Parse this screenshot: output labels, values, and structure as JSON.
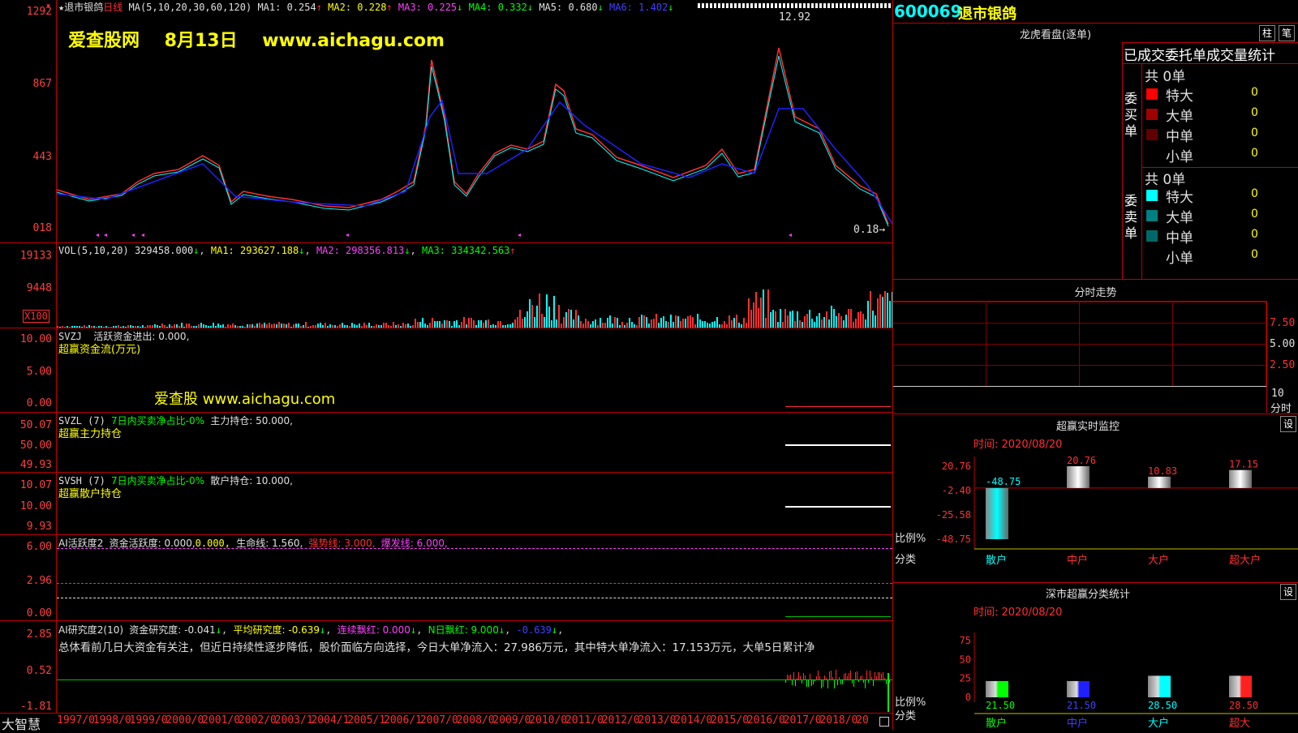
{
  "stock": {
    "code": "600069",
    "name": "退市银鸽"
  },
  "main_header": {
    "star": "★",
    "name": "退市银鸽",
    "period": "日线",
    "ma_def": "MA(5,10,20,30,60,120)",
    "ma1": "MA1: 0.254",
    "ma2": "MA2: 0.228",
    "ma3": "MA3: 0.225",
    "ma4": "MA4: 0.332",
    "ma5": "MA5: 0.680",
    "ma6": "MA6: 1.402"
  },
  "watermark": {
    "site": "爱查股网",
    "date": "8月13日",
    "url": "www.aichagu.com",
    "url2": "爱查股 www.aichagu.com"
  },
  "price_axis": [
    "1292",
    "867",
    "443",
    "018"
  ],
  "price_marks": {
    "high": "12.92",
    "low": "0.18"
  },
  "vol": {
    "def": "VOL(5,10,20)",
    "value": "329458.000",
    "ma1": "MA1: 293627.188",
    "ma2": "MA2: 298356.813",
    "ma3": "MA3: 334342.563",
    "axis": [
      "19133",
      "9448"
    ],
    "unit": "X100"
  },
  "svzj": {
    "name": "SVZJ",
    "label": "活跃资金进出: 0.000,",
    "title": "超赢资金流(万元)",
    "axis": [
      "10.00",
      "5.00",
      "0.00"
    ]
  },
  "svzl": {
    "name": "SVZL (7)",
    "green": "7日内买卖净占比-0%",
    "label": "主力持仓: 50.000,",
    "title": "超赢主力持仓",
    "axis": [
      "50.07",
      "50.00",
      "49.93"
    ]
  },
  "svsh": {
    "name": "SVSH (7)",
    "green": "7日内买卖净占比-0%",
    "label": "散户持仓: 10.000,",
    "title": "超赢散户持仓",
    "axis": [
      "10.07",
      "10.00",
      "9.93"
    ]
  },
  "ai1": {
    "name": "AI活跃度2",
    "l1": "资金活跃度: 0.000,",
    "l2": "0.000,",
    "l3": "生命线: 1.560,",
    "l4": "强势线: 3.000,",
    "l5": "爆发线: 6.000,",
    "axis": [
      "6.00",
      "2.96",
      "0.00"
    ]
  },
  "ai2": {
    "name": "AI研究度2(10)",
    "l1": "资金研究度: -0.041",
    "l2": "平均研究度: -0.639",
    "l3": "连续飘红: 0.000",
    "l4": "N日飘红: 9.000",
    "l5": "-0.639",
    "text": "总体看前几日大资金有关注，但近日持续性逐步降低，股价面临方向选择，今日大单净流入：27.986万元，其中特大单净流入：17.153万元，大单5日累计净",
    "axis": [
      "2.85",
      "0.52",
      "-1.81"
    ]
  },
  "brand": "大智慧",
  "years": [
    "1997/0",
    "1998/0",
    "1999/0",
    "2000/0",
    "2001/0",
    "2002/0",
    "2003/1",
    "2004/1",
    "2005/1",
    "2006/1",
    "2007/0",
    "2008/0",
    "2009/0",
    "2010/0",
    "2011/0",
    "2012/0",
    "2013/0",
    "2014/0",
    "2015/0",
    "2016/0",
    "2017/0",
    "2018/0",
    "20"
  ],
  "lhb": {
    "title": "龙虎看盘(逐单)",
    "btn1": "柱",
    "btn2": "笔",
    "subtitle": "已成交委托单成交量统计",
    "buy_label": "委买单",
    "sell_label": "委卖单",
    "buy": {
      "total": "共 0单",
      "rows": [
        {
          "name": "特大",
          "val": "0",
          "color": "#ff0000"
        },
        {
          "name": "大单",
          "val": "0",
          "color": "#a00000"
        },
        {
          "name": "中单",
          "val": "0",
          "color": "#600000"
        },
        {
          "name": "小单",
          "val": "0",
          "color": "#000000"
        }
      ]
    },
    "sell": {
      "total": "共 0单",
      "rows": [
        {
          "name": "特大",
          "val": "0",
          "color": "#00ffff"
        },
        {
          "name": "大单",
          "val": "0",
          "color": "#008080"
        },
        {
          "name": "中单",
          "val": "0",
          "color": "#006868"
        },
        {
          "name": "小单",
          "val": "0",
          "color": "#000000"
        }
      ]
    }
  },
  "fenshi": {
    "title": "分时走势",
    "axis": [
      "7.50",
      "5.00",
      "2.50"
    ],
    "xlabel_top": "10",
    "xlabel_bottom": "分时"
  },
  "monitor": {
    "title": "超赢实时监控",
    "btn": "设",
    "time": "时间: 2020/08/20",
    "axis": [
      "20.76",
      "-2.40",
      "-25.58",
      "-48.75"
    ],
    "ylabel": "比例%",
    "xlabel": "分类",
    "bars": [
      {
        "name": "散户",
        "value": -48.75,
        "label": "-48.75",
        "color": "#00ffff",
        "lcolor": "#00ffff"
      },
      {
        "name": "中户",
        "value": 20.76,
        "label": "20.76",
        "color": "#ffffff",
        "lcolor": "#ff3030"
      },
      {
        "name": "大户",
        "value": 10.83,
        "label": "10.83",
        "color": "#ffffff",
        "lcolor": "#ff3030"
      },
      {
        "name": "超大户",
        "value": 17.15,
        "label": "17.15",
        "color": "#ffffff",
        "lcolor": "#ff3030"
      }
    ]
  },
  "stat": {
    "title": "深市超赢分类统计",
    "btn": "设",
    "time": "时间: 2020/08/20",
    "axis": [
      "75",
      "50",
      "25",
      "0"
    ],
    "ylabel": "比例%",
    "xlabel": "分类",
    "bars": [
      {
        "name": "散户",
        "value": 21.5,
        "label": "21.50",
        "color": "#00ff00"
      },
      {
        "name": "中户",
        "value": 21.5,
        "label": "21.50",
        "color": "#2020ff"
      },
      {
        "name": "大户",
        "value": 28.5,
        "label": "28.50",
        "color": "#00ffff"
      },
      {
        "name": "超大",
        "value": 28.5,
        "label": "28.50",
        "color": "#ff2020"
      }
    ]
  },
  "colors": {
    "grid": "#c00000",
    "up": "#ff3030",
    "down": "#00ffff",
    "ma": "#2020ff"
  }
}
